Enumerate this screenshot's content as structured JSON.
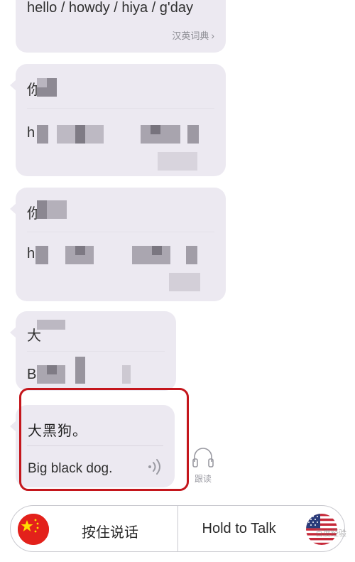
{
  "chat": {
    "messages": [
      {
        "translation_text": "hello / howdy / hiya / g'day",
        "dictionary_link": "汉英词典",
        "blurred": false
      },
      {
        "blurred": true,
        "source_lead": "你",
        "translation_lead": "h"
      },
      {
        "blurred": true,
        "source_lead": "你",
        "translation_lead": "h"
      },
      {
        "blurred": true,
        "source_lead": "大",
        "translation_lead": "B"
      },
      {
        "blurred": false,
        "source_text": "大黑狗。",
        "translation_text": "Big black dog.",
        "highlighted": true
      }
    ],
    "follow_read_label": "跟读"
  },
  "bottom_bar": {
    "left_button_label": "按住说话",
    "right_button_label": "Hold to Talk",
    "left_language": "china-flag-icon",
    "right_language": "usa-flag-icon"
  },
  "watermark": "百度经验",
  "colors": {
    "bubble": "#ece9f1",
    "highlight_border": "#c4161c",
    "china_flag_red": "#e3211b",
    "china_flag_star": "#ffde00"
  }
}
